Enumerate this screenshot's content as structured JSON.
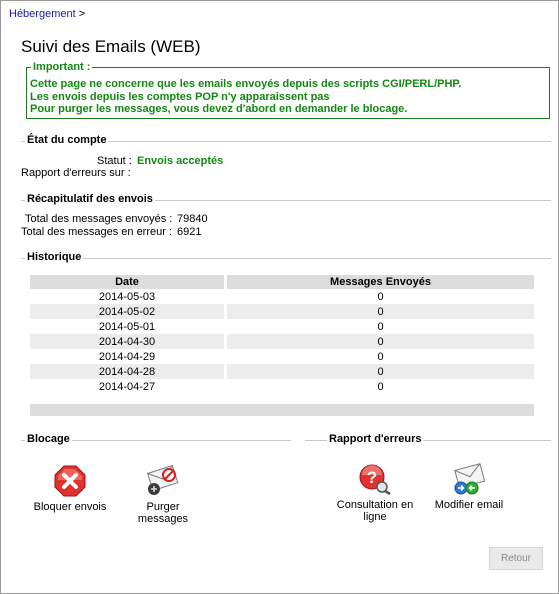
{
  "breadcrumb": {
    "link": "Hébergement",
    "sep": ">"
  },
  "page_title": "Suivi des Emails (WEB)",
  "important": {
    "legend": "Important :",
    "lines": [
      "Cette page ne concerne que les emails envoyés depuis des scripts CGI/PERL/PHP.",
      "Les envois depuis les comptes POP n'y apparaissent pas",
      "Pour purger les messages, vous devez d'abord en demander le blocage."
    ]
  },
  "account": {
    "section": "État du compte",
    "status_label": "Statut :",
    "status_value": "Envois acceptés",
    "report_label": "Rapport d'erreurs sur :",
    "report_value": ""
  },
  "summary": {
    "section": "Récapitulatif des envois",
    "total_sent_label": "Total des messages envoyés :",
    "total_sent_value": "79840",
    "total_err_label": "Total des messages en erreur :",
    "total_err_value": "6921"
  },
  "history": {
    "section": "Historique",
    "columns": [
      "Date",
      "Messages Envoyés"
    ],
    "rows": [
      [
        "2014-05-03",
        "0"
      ],
      [
        "2014-05-02",
        "0"
      ],
      [
        "2014-05-01",
        "0"
      ],
      [
        "2014-04-30",
        "0"
      ],
      [
        "2014-04-29",
        "0"
      ],
      [
        "2014-04-28",
        "0"
      ],
      [
        "2014-04-27",
        "0"
      ]
    ]
  },
  "blocage": {
    "section": "Blocage",
    "block_label": "Bloquer envois",
    "purge_label_1": "Purger",
    "purge_label_2": "messages"
  },
  "error_report": {
    "section": "Rapport d'erreurs",
    "consult_label_1": "Consultation en",
    "consult_label_2": "ligne",
    "modify_label": "Modifier email"
  },
  "back_button": "Retour",
  "colors": {
    "accent_green": "#138813",
    "link_blue": "#1a1aa6"
  }
}
